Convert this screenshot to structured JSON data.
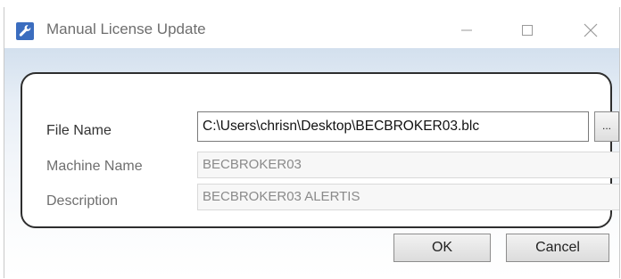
{
  "window": {
    "title": "Manual License Update"
  },
  "form": {
    "file_name_label": "File Name",
    "file_name_value": "C:\\Users\\chrisn\\Desktop\\BECBROKER03.blc",
    "browse_label": "...",
    "machine_name_label": "Machine Name",
    "machine_name_value": "BECBROKER03",
    "description_label": "Description",
    "description_value": "BECBROKER03 ALERTIS"
  },
  "buttons": {
    "ok_label": "OK",
    "cancel_label": "Cancel"
  },
  "colors": {
    "app_icon": "#3b6dbf",
    "panel_border": "#2e2e2e",
    "client_gradient_top": "#d3e0ee"
  },
  "icons": [
    "wrench-icon",
    "minimize-icon",
    "maximize-icon",
    "close-icon"
  ]
}
